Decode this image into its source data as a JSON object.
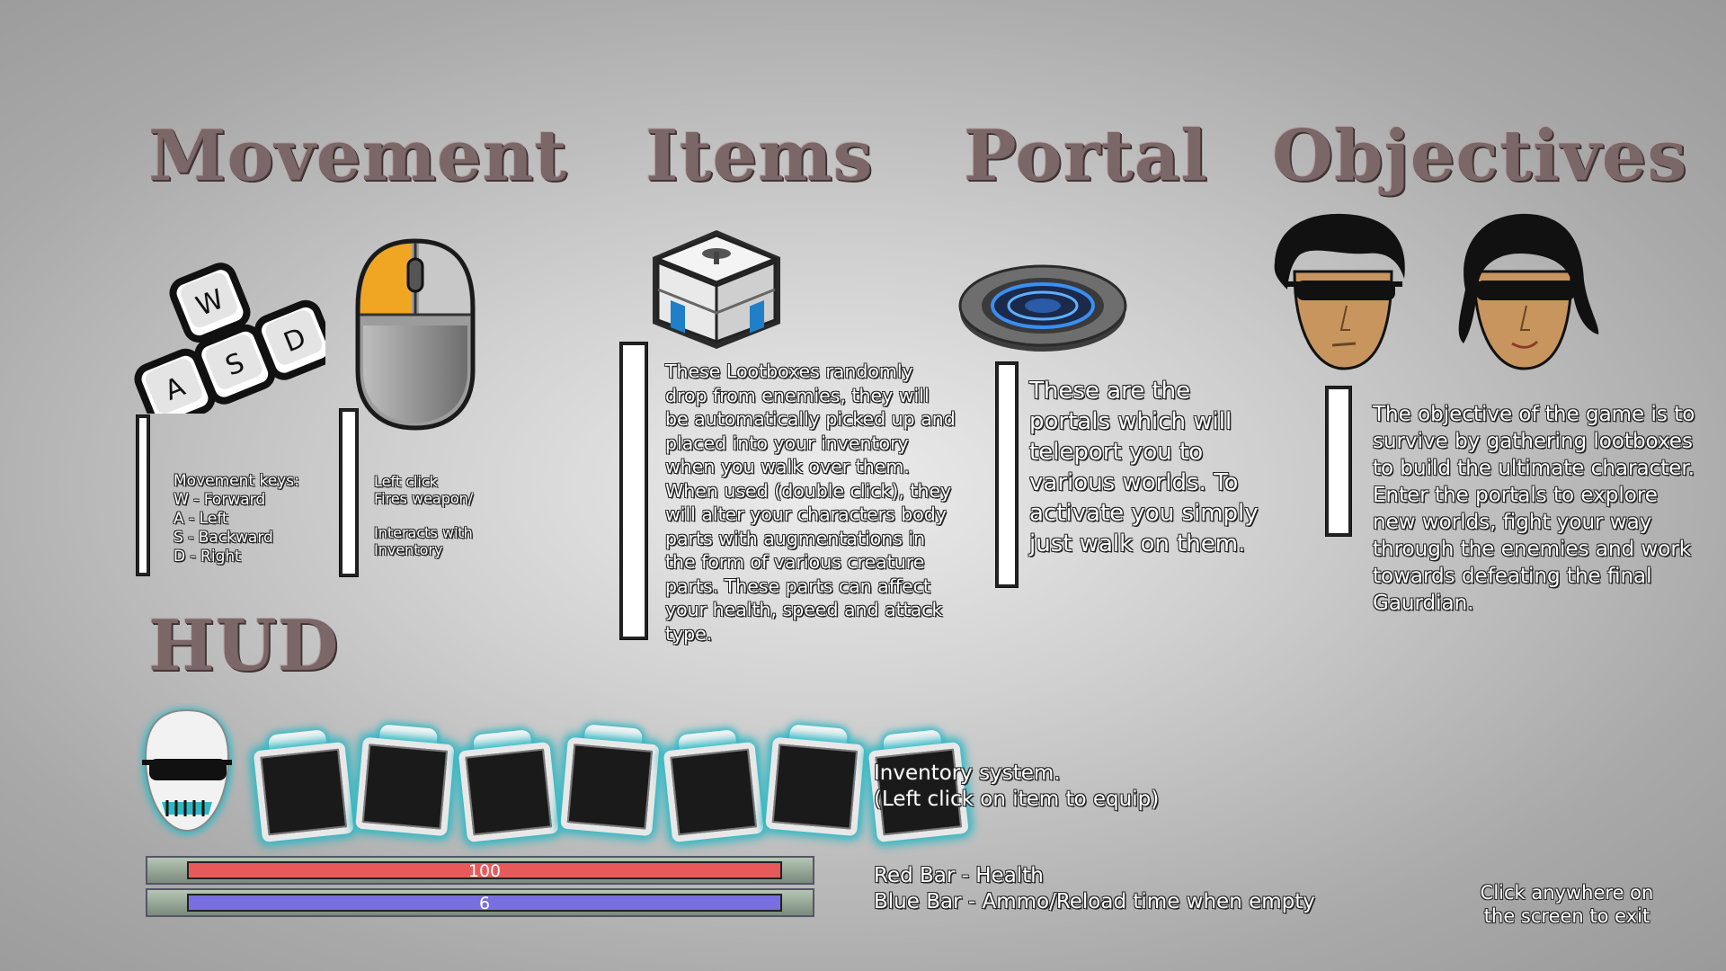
{
  "headings": {
    "movement": "Movement",
    "items": "Items",
    "portal": "Portal",
    "objectives": "Objectives",
    "hud": "HUD"
  },
  "movement": {
    "keys_text": "Movement keys:\nW - Forward\nA - Left\nS - Backward\nD - Right",
    "key_caps": [
      "W",
      "A",
      "S",
      "D"
    ],
    "mouse_text": "Left click\nFires weapon/\n\nInteracts with\nInventory"
  },
  "items": {
    "text": "These Lootboxes randomly\ndrop from enemies, they will\nbe automatically picked up and\nplaced into your inventory\nwhen you walk over them.\nWhen used (double click), they\nwill alter your characters body\nparts with augmentations in\nthe form of various creature\nparts. These parts can affect\nyour health, speed and attack\ntype."
  },
  "portal": {
    "text": "These are the\nportals which will\nteleport you to\nvarious worlds. To\nactivate you simply\njust walk on them."
  },
  "objectives": {
    "text": "The objective of the game is to\nsurvive by gathering lootboxes\nto build the ultimate character.\nEnter the portals to explore\nnew worlds, fight your way\nthrough the enemies and work\ntowards defeating the final\nGaurdian."
  },
  "hud": {
    "inventory_text": "Inventory system.\n(Left click on item to equip)",
    "bars_text": "Red Bar - Health\nBlue Bar - Ammo/Reload time when empty",
    "health_value": "100",
    "ammo_value": "6",
    "health_fraction": 1.0,
    "ammo_fraction": 1.0,
    "inventory_slot_count": 7,
    "colors": {
      "health": "#e85a5a",
      "ammo": "#7a6fe0",
      "glow": "#2fb8c4"
    }
  },
  "exit_text": "Click anywhere on\nthe screen to exit"
}
